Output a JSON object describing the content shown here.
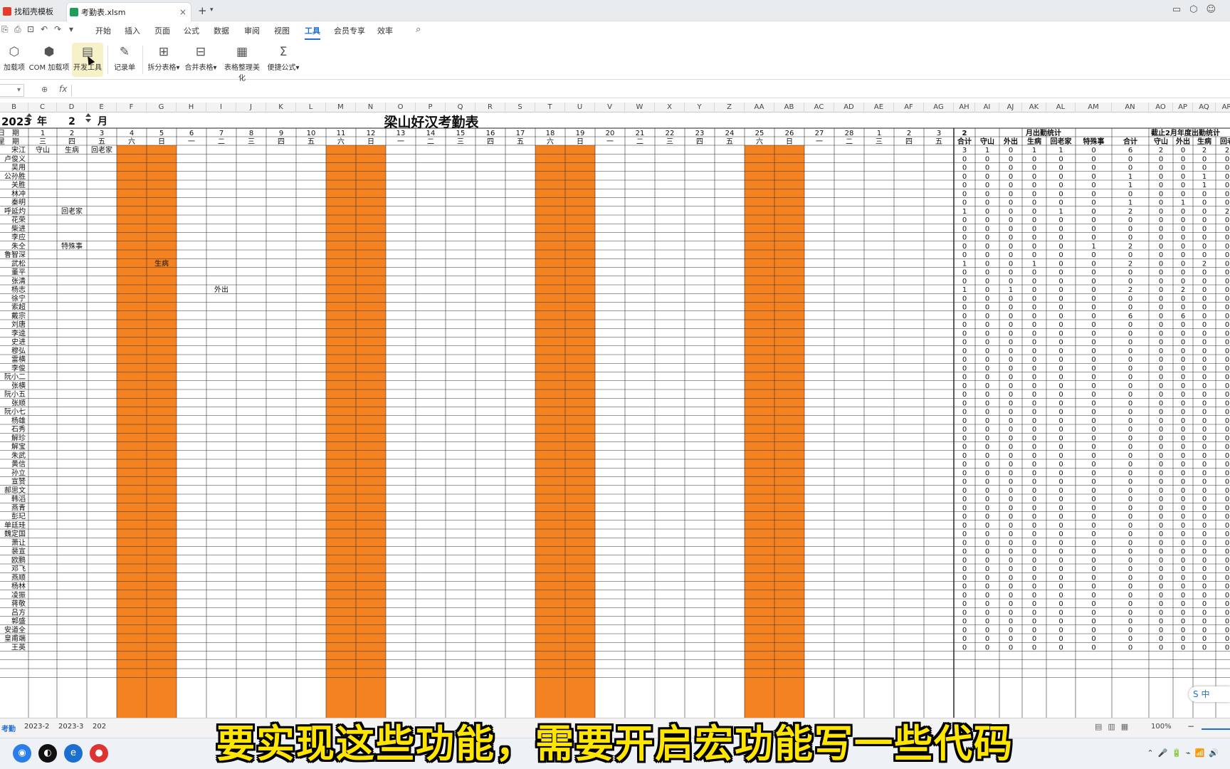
{
  "titlebar": {
    "tabs": [
      {
        "label": "找稻壳模板",
        "icon": "wps-icon",
        "color": "#e23c2f"
      },
      {
        "label": "考勤表.xlsm",
        "icon": "spreadsheet-icon",
        "color": "#1e9e5a"
      }
    ]
  },
  "menu": {
    "items": [
      "开始",
      "插入",
      "页面",
      "公式",
      "数据",
      "审阅",
      "视图",
      "工具",
      "会员专享",
      "效率"
    ],
    "active": "工具"
  },
  "ribbon": {
    "buttons": [
      "加载项",
      "COM 加载项",
      "开发工具",
      "记录单",
      "拆分表格",
      "合并表格",
      "表格整理美化",
      "便捷公式"
    ]
  },
  "formula": {
    "fx": "fx"
  },
  "sheet": {
    "column_headers": [
      "B",
      "C",
      "D",
      "E",
      "F",
      "G",
      "H",
      "I",
      "J",
      "K",
      "L",
      "M",
      "N",
      "O",
      "P",
      "Q",
      "R",
      "S",
      "T",
      "U",
      "V",
      "W",
      "X",
      "Y",
      "Z",
      "AA",
      "AB",
      "AC",
      "AD",
      "AE",
      "AF",
      "AG",
      "AH",
      "AI",
      "AJ",
      "AK",
      "AL",
      "AM",
      "AN",
      "AO",
      "AP",
      "AQ",
      "AR"
    ],
    "year": "2023",
    "year_label": "年",
    "month": "2",
    "month_label": "月",
    "title": "梁山好汉考勤表",
    "date_label": "日　期",
    "weekday_label": "星　期",
    "days": [
      "1",
      "2",
      "3",
      "4",
      "5",
      "6",
      "7",
      "8",
      "9",
      "10",
      "11",
      "12",
      "13",
      "14",
      "15",
      "16",
      "17",
      "18",
      "19",
      "20",
      "21",
      "22",
      "23",
      "24",
      "25",
      "26",
      "27",
      "28",
      "1",
      "2",
      "3"
    ],
    "weekdays": [
      "三",
      "四",
      "五",
      "六",
      "日",
      "一",
      "二",
      "三",
      "四",
      "五",
      "六",
      "日",
      "一",
      "二",
      "三",
      "四",
      "五",
      "六",
      "日",
      "一",
      "二",
      "三",
      "四",
      "五",
      "六",
      "日",
      "一",
      "二",
      "三",
      "四",
      "五"
    ],
    "weekend_color": "#f58220",
    "monthly_stats_month": "2",
    "monthly_stats_title": "月出勤统计",
    "ytd_stats_title": "截止2月年度出勤统计",
    "stat_headers": [
      "合计",
      "守山",
      "外出",
      "生病",
      "回老家",
      "特殊事"
    ],
    "ytd_headers": [
      "合计",
      "守山",
      "外出",
      "生病",
      "回老"
    ],
    "names": [
      "宋江",
      "卢俊义",
      "吴用",
      "公孙胜",
      "关胜",
      "林冲",
      "秦明",
      "呼延灼",
      "花荣",
      "柴进",
      "李应",
      "朱仝",
      "鲁智深",
      "武松",
      "董平",
      "张清",
      "杨志",
      "徐宁",
      "索超",
      "戴宗",
      "刘唐",
      "李逵",
      "史进",
      "穆弘",
      "雷横",
      "李俊",
      "阮小二",
      "张横",
      "阮小五",
      "张顺",
      "阮小七",
      "杨雄",
      "石秀",
      "解珍",
      "解宝",
      "朱武",
      "黄信",
      "孙立",
      "宣赞",
      "郝思文",
      "韩滔",
      "彭玘",
      "单廷珪",
      "魏定国",
      "萧让",
      "裴宣",
      "欧鹏",
      "邓飞",
      "燕顺",
      "杨林",
      "凌振",
      "蒋敬",
      "吕方",
      "郭盛",
      "安道全",
      "皇甫端",
      "王英"
    ],
    "names_visible": [
      "宋江",
      "卢俊义",
      "吴用",
      "公孙胜",
      "关胜",
      "林冲",
      "秦明",
      "呼延灼",
      "花荣",
      "柴进",
      "李应",
      "朱仝",
      "鲁智深",
      "武松",
      "董平",
      "张清",
      "杨志",
      "徐宁",
      "索超",
      "戴宗",
      "刘唐",
      "李逵",
      "史进",
      "穆弘",
      "雷横",
      "李俊",
      "阮小二",
      "张横",
      "阮小五",
      "张顺",
      "阮小七",
      "杨雄",
      "石秀",
      "解珍",
      "解宝",
      "朱武",
      "黄信",
      "孙立",
      "宣赞",
      "郝思文",
      "韩滔",
      "燕青",
      "彭玘",
      "单廷珪",
      "魏定国",
      "萧让",
      "裴宣",
      "欧鹏",
      "邓飞",
      "燕顺",
      "杨林",
      "凌振",
      "蒋敬",
      "吕方",
      "郭盛",
      "安道全",
      "皇甫端",
      "王英"
    ],
    "entries": [
      {
        "row": 0,
        "day": 1,
        "text": "守山"
      },
      {
        "row": 0,
        "day": 2,
        "text": "生病"
      },
      {
        "row": 0,
        "day": 3,
        "text": "回老家"
      },
      {
        "row": 7,
        "day": 2,
        "text": "回老家"
      },
      {
        "row": 11,
        "day": 2,
        "text": "特殊事"
      },
      {
        "row": 13,
        "day": 5,
        "text": "生病"
      },
      {
        "row": 16,
        "day": 7,
        "text": "外出"
      }
    ],
    "monthly_stats": [
      [
        "3",
        "1",
        "0",
        "1",
        "1",
        "0"
      ],
      [
        "0",
        "0",
        "0",
        "0",
        "0",
        "0"
      ],
      [
        "0",
        "0",
        "0",
        "0",
        "0",
        "0"
      ],
      [
        "0",
        "0",
        "0",
        "0",
        "0",
        "0"
      ],
      [
        "0",
        "0",
        "0",
        "0",
        "0",
        "0"
      ],
      [
        "0",
        "0",
        "0",
        "0",
        "0",
        "0"
      ],
      [
        "0",
        "0",
        "0",
        "0",
        "0",
        "0"
      ],
      [
        "1",
        "0",
        "0",
        "0",
        "1",
        "0"
      ],
      [
        "0",
        "0",
        "0",
        "0",
        "0",
        "0"
      ],
      [
        "0",
        "0",
        "0",
        "0",
        "0",
        "0"
      ],
      [
        "0",
        "0",
        "0",
        "0",
        "0",
        "0"
      ],
      [
        "0",
        "0",
        "0",
        "0",
        "0",
        "1"
      ],
      [
        "0",
        "0",
        "0",
        "0",
        "0",
        "0"
      ],
      [
        "1",
        "0",
        "0",
        "1",
        "0",
        "0"
      ],
      [
        "0",
        "0",
        "0",
        "0",
        "0",
        "0"
      ],
      [
        "0",
        "0",
        "0",
        "0",
        "0",
        "0"
      ],
      [
        "1",
        "0",
        "1",
        "0",
        "0",
        "0"
      ]
    ],
    "ytd_stats": [
      [
        "6",
        "2",
        "0",
        "2",
        "2"
      ],
      [
        "0",
        "0",
        "0",
        "0",
        "0"
      ],
      [
        "0",
        "0",
        "0",
        "0",
        "0"
      ],
      [
        "1",
        "0",
        "0",
        "1",
        "0"
      ],
      [
        "1",
        "0",
        "0",
        "1",
        "0"
      ],
      [
        "0",
        "0",
        "0",
        "0",
        "0"
      ],
      [
        "1",
        "0",
        "1",
        "0",
        "0"
      ],
      [
        "2",
        "0",
        "0",
        "0",
        "2"
      ],
      [
        "0",
        "0",
        "0",
        "0",
        "0"
      ],
      [
        "0",
        "0",
        "0",
        "0",
        "0"
      ],
      [
        "0",
        "0",
        "0",
        "0",
        "0"
      ],
      [
        "2",
        "0",
        "0",
        "0",
        "0"
      ],
      [
        "0",
        "0",
        "0",
        "0",
        "0"
      ],
      [
        "2",
        "0",
        "0",
        "2",
        "0"
      ],
      [
        "0",
        "0",
        "0",
        "0",
        "0"
      ],
      [
        "0",
        "0",
        "0",
        "0",
        "0"
      ],
      [
        "2",
        "0",
        "2",
        "0",
        "0"
      ],
      [
        "0",
        "0",
        "0",
        "0",
        "0"
      ],
      [
        "0",
        "0",
        "0",
        "0",
        "0"
      ],
      [
        "6",
        "0",
        "6",
        "0",
        "0"
      ]
    ],
    "zero": "0"
  },
  "sheet_tabs": {
    "current": "考勤",
    "tabs": [
      "2023-2",
      "2023-3",
      "202"
    ]
  },
  "statusbar": {
    "zoom": "100%"
  },
  "ime": {
    "label": "中"
  },
  "subtitle": "要实现这些功能，需要开启宏功能写一些代码"
}
